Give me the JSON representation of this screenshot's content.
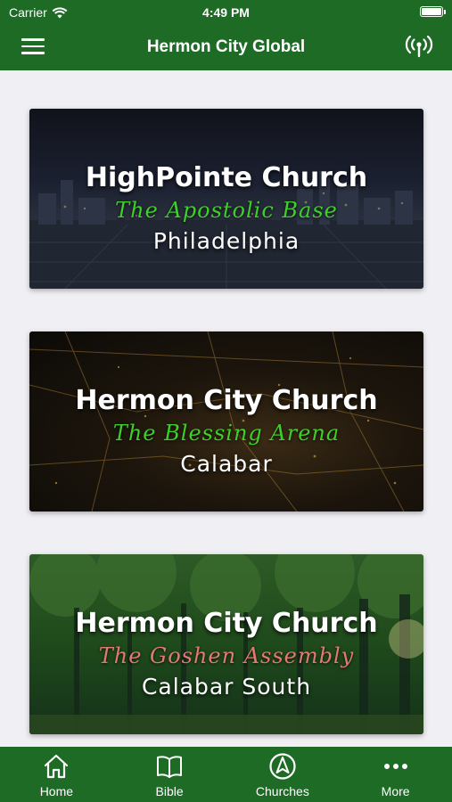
{
  "status_bar": {
    "carrier": "Carrier",
    "time": "4:49 PM"
  },
  "nav": {
    "title": "Hermon City Global",
    "menu_icon": "hamburger-menu-icon",
    "live_icon": "broadcast-antenna-icon"
  },
  "churches": [
    {
      "name": "HighPointe Church",
      "tagline": "The Apostolic Base",
      "city": "Philadelphia",
      "tagline_color": "#3ecf2a"
    },
    {
      "name": "Hermon City Church",
      "tagline": "The Blessing Arena",
      "city": "Calabar",
      "tagline_color": "#3ecf2a"
    },
    {
      "name": "Hermon City Church",
      "tagline": "The Goshen Assembly",
      "city": "Calabar South",
      "tagline_color": "#e07a72"
    }
  ],
  "tabs": [
    {
      "label": "Home",
      "icon": "home-icon"
    },
    {
      "label": "Bible",
      "icon": "book-icon"
    },
    {
      "label": "Churches",
      "icon": "compass-icon"
    },
    {
      "label": "More",
      "icon": "more-dots-icon"
    }
  ],
  "colors": {
    "brand_green": "#1e6b26",
    "background": "#efeff4"
  }
}
